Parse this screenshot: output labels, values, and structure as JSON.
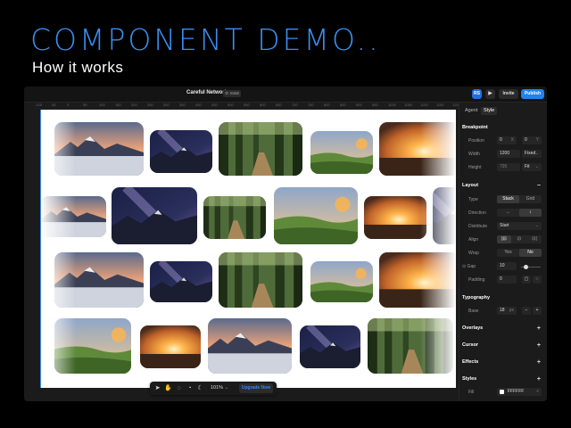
{
  "slide": {
    "headline": "COMPONENT DEMO..",
    "subline": "How it works"
  },
  "topbar": {
    "project_name": "Careful Network",
    "project_badge": "⊘ saas",
    "avatar": "RS",
    "play_icon": "play-icon",
    "invite_label": "Invite",
    "publish_label": "Publish",
    "accent": "#1f83f0"
  },
  "ruler": {
    "ticks": [
      "-100",
      "-50",
      "0",
      "50",
      "100",
      "150",
      "200",
      "250",
      "300",
      "350",
      "400",
      "450",
      "500",
      "550",
      "600",
      "650",
      "700",
      "750",
      "800",
      "850",
      "900",
      "950",
      "1000",
      "1050",
      "1100",
      "1150",
      "1200"
    ]
  },
  "toolbar": {
    "zoom": "101%",
    "upgrade_label": "Upgrade Now",
    "icons": [
      "pointer-icon",
      "hand-icon",
      "comment-icon",
      "chat-icon",
      "moon-icon"
    ]
  },
  "panel": {
    "tabs": [
      "Agent",
      "Style"
    ],
    "active_tab": "Style",
    "breakpoint": {
      "title": "Breakpoint",
      "position": {
        "label": "Position",
        "x": "0",
        "x_suffix": "X",
        "y": "0",
        "y_suffix": "Y"
      },
      "width": {
        "label": "Width",
        "value": "1200",
        "mode": "Fixed"
      },
      "height": {
        "label": "Height",
        "value": "795",
        "mode": "Fit"
      }
    },
    "layout": {
      "title": "Layout",
      "collapse": "−",
      "type": {
        "label": "Type",
        "options": [
          "Stack",
          "Grid"
        ],
        "selected": "Stack"
      },
      "direction": {
        "label": "Direction",
        "options": [
          "↔",
          "↕"
        ],
        "selected": "↕"
      },
      "distribute": {
        "label": "Distribute",
        "value": "Start"
      },
      "align": {
        "label": "Align",
        "options": [
          "|⊡",
          "⊡",
          "⊡|"
        ]
      },
      "wrap": {
        "label": "Wrap",
        "options": [
          "Yes",
          "No"
        ],
        "selected": "No"
      },
      "gap": {
        "label": "Gap",
        "value": "10",
        "level": 0.2
      },
      "padding": {
        "label": "Padding",
        "value": "0"
      }
    },
    "typography": {
      "title": "Typography",
      "base": {
        "label": "Base",
        "value": "18",
        "suffix": "px"
      }
    },
    "collapsed_sections": [
      "Overlays",
      "Cursor",
      "Effects"
    ],
    "styles": {
      "title": "Styles",
      "fill": {
        "label": "Fill",
        "value": "FFFFFF"
      }
    }
  },
  "gallery": {
    "scenes": [
      "snowy-mountains-sea-of-clouds",
      "milky-way-mountains",
      "forest-path",
      "green-valley-sunset",
      "desert-sunset-glow"
    ],
    "colors": {
      "dusk_sky": "#e9a27a",
      "night_sky": "#2a2f5c",
      "forest": "#2d4a1e",
      "grass": "#5f8a3a",
      "sun": "#ffb44a"
    }
  }
}
